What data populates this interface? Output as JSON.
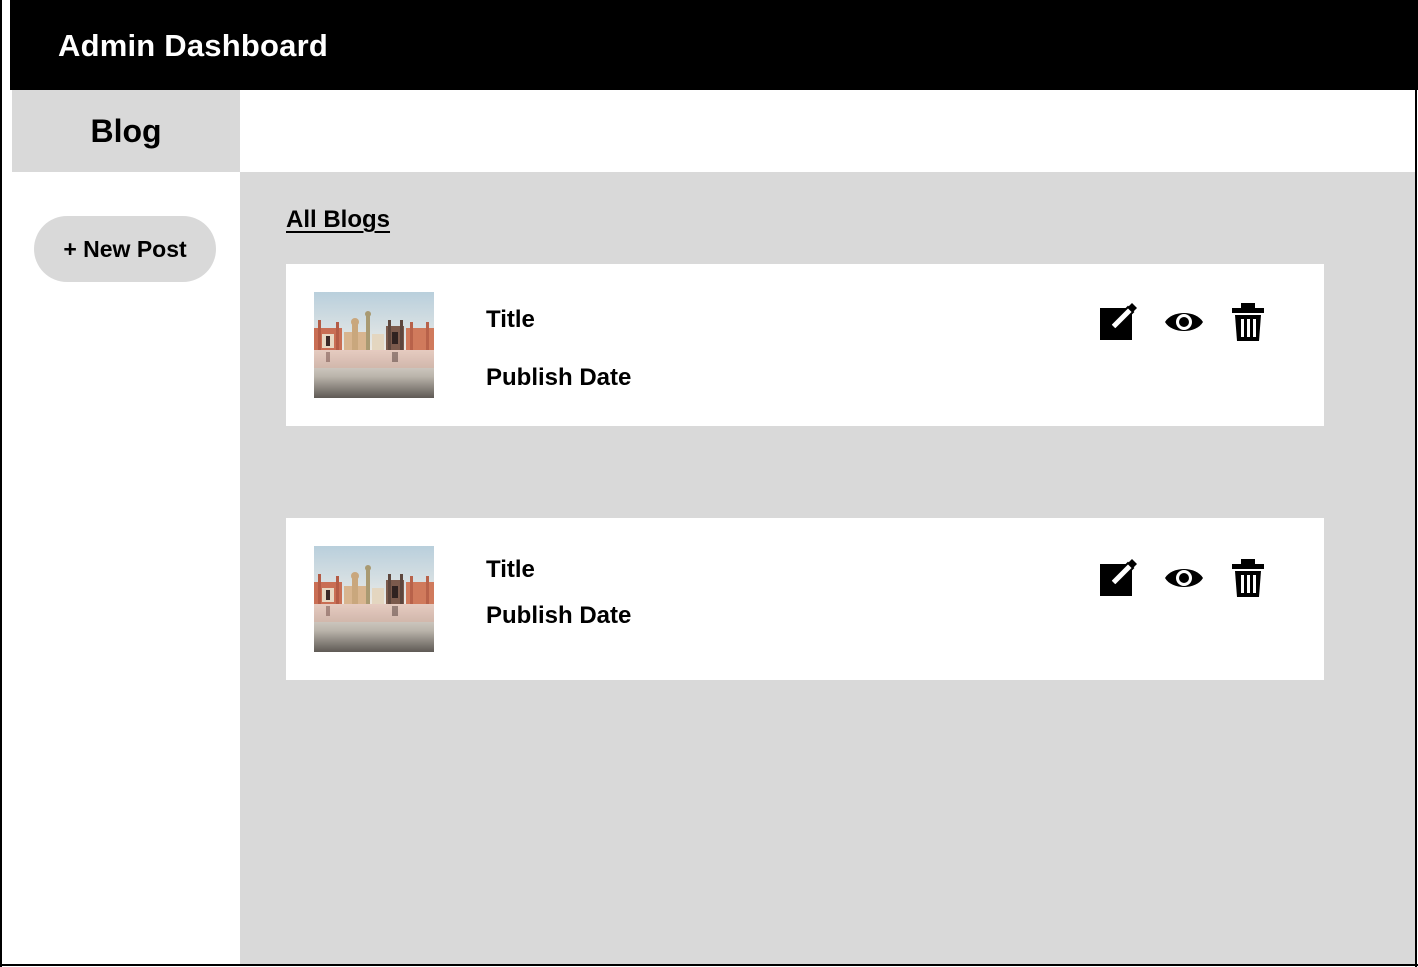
{
  "header": {
    "title": "Admin Dashboard",
    "background": "#000000",
    "text_color": "#ffffff"
  },
  "sidebar": {
    "active_tab": "Blog",
    "new_post_label": "+ New Post"
  },
  "main": {
    "section_title": "All Blogs",
    "panel_color": "#d9d9d9",
    "posts": [
      {
        "title": "Title",
        "date_label": "Publish Date",
        "thumbnail": "cityscape-image",
        "actions": [
          "edit-icon",
          "view-icon",
          "delete-icon"
        ]
      },
      {
        "title": "Title",
        "date_label": "Publish Date",
        "thumbnail": "cityscape-image",
        "actions": [
          "edit-icon",
          "view-icon",
          "delete-icon"
        ]
      }
    ]
  }
}
